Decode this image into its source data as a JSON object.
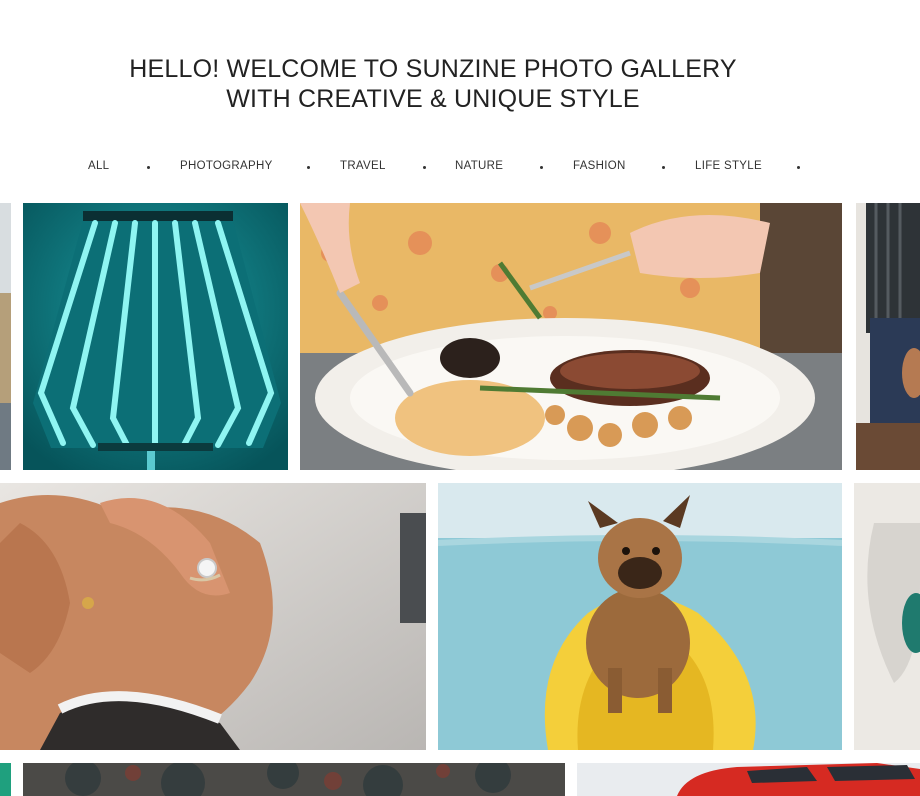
{
  "hero": {
    "line1": "HELLO! WELCOME TO SUNZINE PHOTO GALLERY",
    "line2": "WITH CREATIVE & UNIQUE STYLE"
  },
  "filters": [
    "ALL",
    "PHOTOGRAPHY",
    "TRAVEL",
    "NATURE",
    "FASHION",
    "LIFE STYLE"
  ],
  "gallery": {
    "photos": [
      {
        "subject": "landscape-partial"
      },
      {
        "subject": "teal-lamp"
      },
      {
        "subject": "steak-dinner"
      },
      {
        "subject": "person-partial"
      },
      {
        "subject": "ring-hands"
      },
      {
        "subject": "dog-on-kayak"
      },
      {
        "subject": "abstract-partial"
      },
      {
        "subject": "green-partial"
      },
      {
        "subject": "tattoo"
      },
      {
        "subject": "red-car"
      }
    ]
  },
  "colors": {
    "text": "#222222",
    "background": "#ffffff",
    "lamp_teal": "#0f7f85",
    "lamp_light": "#7ff0ee",
    "kayak_yellow": "#f4cf3a",
    "sea_blue": "#8ec9d6",
    "car_red": "#d62a22"
  }
}
